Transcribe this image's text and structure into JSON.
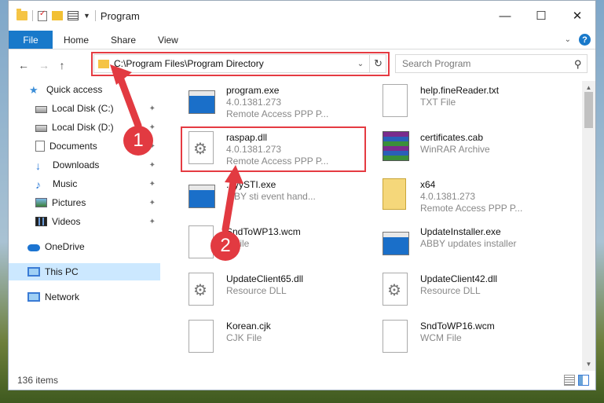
{
  "window": {
    "title": "Program",
    "minimize": "—",
    "maximize": "☐",
    "close": "✕"
  },
  "ribbon": {
    "file": "File",
    "home": "Home",
    "share": "Share",
    "view": "View",
    "collapse": "⌄",
    "help": "?"
  },
  "navigation": {
    "back": "←",
    "forward": "→",
    "up": "↑",
    "address": "C:\\Program Files\\Program Directory",
    "address_dropdown": "⌄",
    "refresh": "↻",
    "search_placeholder": "Search Program",
    "search_icon": "⚲"
  },
  "sidebar": {
    "items": [
      {
        "label": "Quick access",
        "icon": "star-icon"
      },
      {
        "label": "Local Disk (C:)",
        "icon": "disk-icon",
        "pinned": true
      },
      {
        "label": "Local Disk (D:)",
        "icon": "disk-icon",
        "pinned": true
      },
      {
        "label": "Documents",
        "icon": "documents-icon",
        "pinned": true
      },
      {
        "label": "Downloads",
        "icon": "download-icon",
        "pinned": true
      },
      {
        "label": "Music",
        "icon": "music-icon",
        "pinned": true
      },
      {
        "label": "Pictures",
        "icon": "pictures-icon",
        "pinned": true
      },
      {
        "label": "Videos",
        "icon": "videos-icon",
        "pinned": true
      },
      {
        "label": "OneDrive",
        "icon": "cloud-icon"
      },
      {
        "label": "This PC",
        "icon": "pc-icon",
        "selected": true
      },
      {
        "label": "Network",
        "icon": "network-icon"
      }
    ],
    "pin_glyph": "📌"
  },
  "files": [
    {
      "name": "program.exe",
      "line2": "4.0.1381.273",
      "line3": "Remote Access PPP P...",
      "icon": "app-icon"
    },
    {
      "name": "help.fineReader.txt",
      "line2": "TXT File",
      "line3": "",
      "icon": "text-file-icon"
    },
    {
      "name": "raspap.dll",
      "line2": "4.0.1381.273",
      "line3": "Remote Access PPP P...",
      "icon": "dll-gear-icon"
    },
    {
      "name": "certificates.cab",
      "line2": "WinRAR Archive",
      "line3": "",
      "icon": "cab-archive-icon"
    },
    {
      "name": "...yySTI.exe",
      "line2": "...BY sti event hand...",
      "line3": "",
      "icon": "app-icon"
    },
    {
      "name": "x64",
      "line2": "4.0.1381.273",
      "line3": "Remote Access PPP P...",
      "icon": "folder-file-icon"
    },
    {
      "name": "SndToWP13.wcm",
      "line2": "...File",
      "line3": "",
      "icon": "file-icon"
    },
    {
      "name": "UpdateInstaller.exe",
      "line2": "ABBY updates installer",
      "line3": "",
      "icon": "app-icon"
    },
    {
      "name": "UpdateClient65.dll",
      "line2": "Resource DLL",
      "line3": "",
      "icon": "dll-gear-icon"
    },
    {
      "name": "UpdateClient42.dll",
      "line2": "Resource DLL",
      "line3": "",
      "icon": "dll-gear-icon"
    },
    {
      "name": "Korean.cjk",
      "line2": "CJK File",
      "line3": "",
      "icon": "file-icon"
    },
    {
      "name": "SndToWP16.wcm",
      "line2": "WCM File",
      "line3": "",
      "icon": "file-icon"
    }
  ],
  "status": {
    "count": "136 items"
  },
  "callouts": {
    "one": "1",
    "two": "2"
  },
  "colors": {
    "accent": "#1979ca",
    "highlight": "#e53b42",
    "selected_bg": "#cce8ff"
  }
}
